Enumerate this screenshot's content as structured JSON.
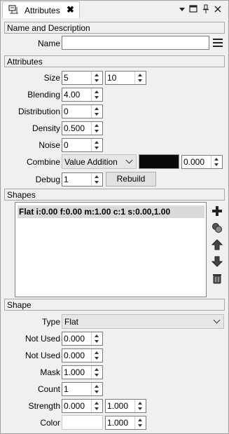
{
  "window": {
    "tab_title": "Attributes",
    "close_glyph": "✖",
    "menu_glyph": "▾",
    "restore_glyph": "▭",
    "pin_glyph": "📌",
    "close_window_glyph": "✕"
  },
  "name_section": {
    "title": "Name and Description",
    "name_label": "Name",
    "name_value": ""
  },
  "attributes": {
    "title": "Attributes",
    "size_label": "Size",
    "size_a": "5",
    "size_b": "10",
    "blending_label": "Blending",
    "blending": "4.00",
    "distribution_label": "Distribution",
    "distribution": "0",
    "density_label": "Density",
    "density": "0.500",
    "noise_label": "Noise",
    "noise": "0",
    "combine_label": "Combine",
    "combine_mode": "Value Addition",
    "combine_color": "#0a0a0a",
    "combine_value": "0.000",
    "debug_label": "Debug",
    "debug": "1",
    "rebuild_label": "Rebuild"
  },
  "shapes": {
    "title": "Shapes",
    "items": [
      "Flat i:0.00 f:0.00 m:1.00 c:1 s:0.00,1.00"
    ]
  },
  "shape": {
    "title": "Shape",
    "type_label": "Type",
    "type_value": "Flat",
    "notused1_label": "Not Used",
    "notused1": "0.000",
    "notused2_label": "Not Used",
    "notused2": "0.000",
    "mask_label": "Mask",
    "mask": "1.000",
    "count_label": "Count",
    "count": "1",
    "strength_label": "Strength",
    "strength_a": "0.000",
    "strength_b": "1.000",
    "color_label": "Color",
    "color_swatch": "#ffffff",
    "color_value": "1.000"
  }
}
